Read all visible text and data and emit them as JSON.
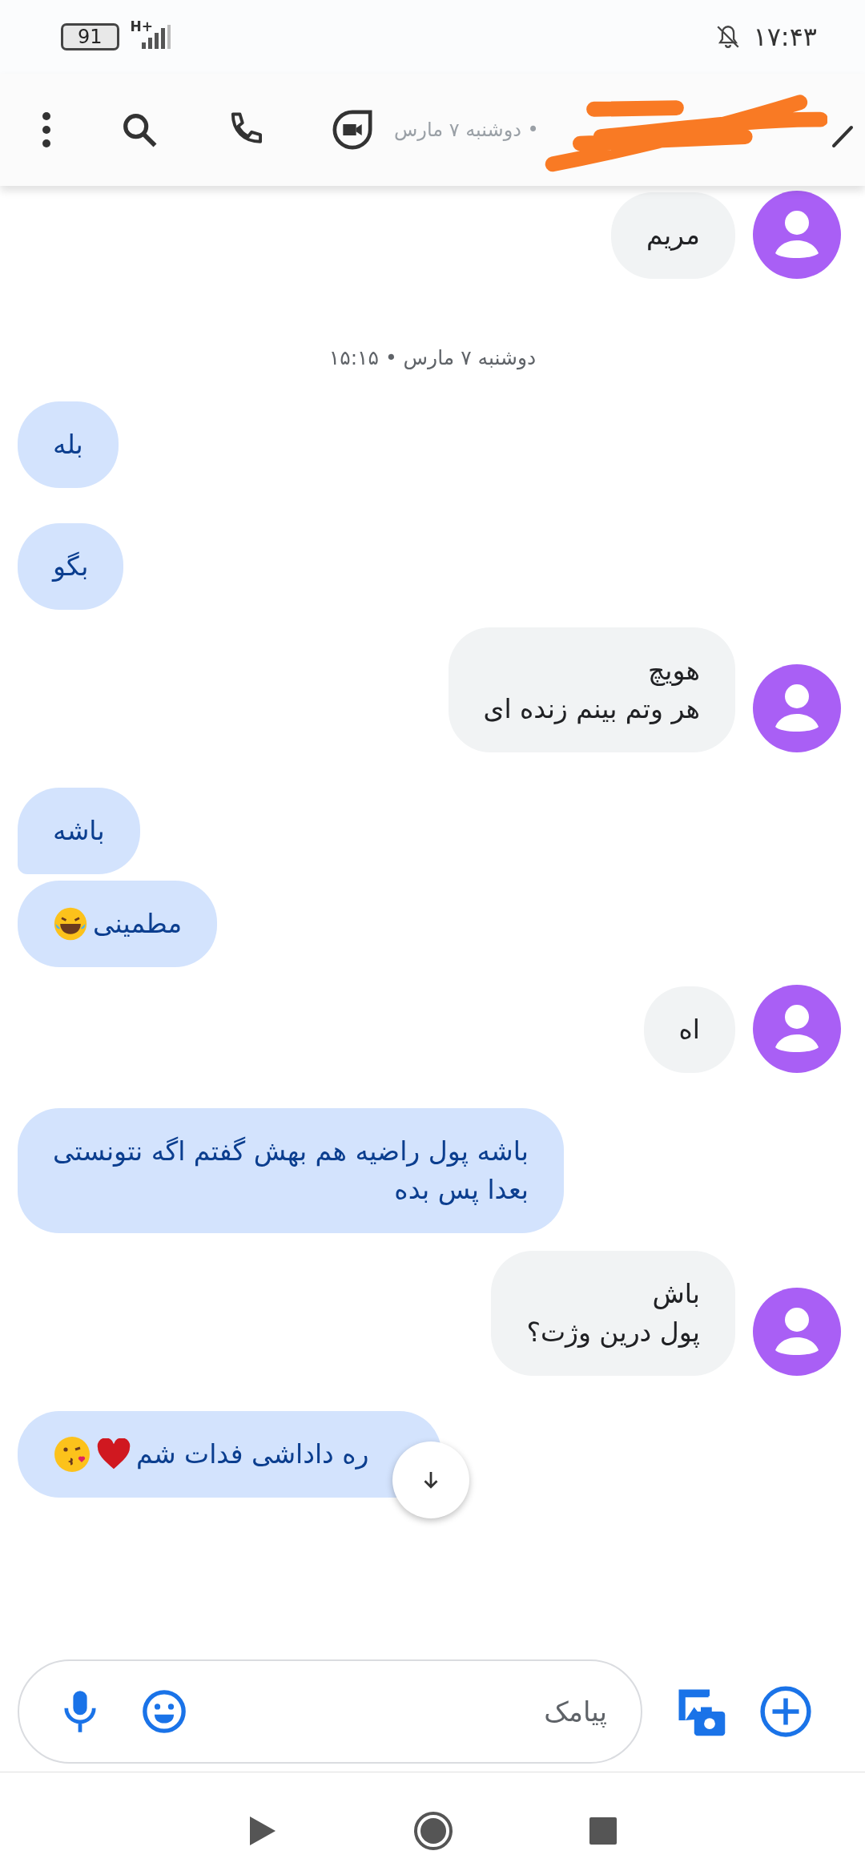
{
  "status_bar": {
    "battery": "91",
    "network": "H+",
    "time": "۱۷:۴۳"
  },
  "header": {
    "subtitle": "دوشنبه ۷ مارس •"
  },
  "messages": [
    {
      "kind": "received",
      "lines": [
        "مریم"
      ]
    },
    {
      "kind": "date",
      "lines": [
        "دوشنبه ۷ مارس • ۱۵:۱۵"
      ]
    },
    {
      "kind": "sent",
      "lines": [
        "بله"
      ]
    },
    {
      "kind": "sent",
      "lines": [
        "بگو"
      ]
    },
    {
      "kind": "received",
      "lines": [
        "هویچ",
        "هر وتم بینم زنده ای"
      ]
    },
    {
      "kind": "sent",
      "lines": [
        "باشه"
      ],
      "grouped": true
    },
    {
      "kind": "sent",
      "lines": [
        "مطمینی"
      ],
      "emoji": [
        {
          "kind": "laugh"
        }
      ]
    },
    {
      "kind": "received",
      "lines": [
        "اه"
      ]
    },
    {
      "kind": "sent",
      "lines": [
        "باشه پول راضیه هم بهش گفتم اگه نتونستی",
        "بعدا پس بده"
      ]
    },
    {
      "kind": "received",
      "lines": [
        "باش",
        "پول درین وژت؟"
      ]
    },
    {
      "kind": "sent",
      "lines": [
        "ره داداشی فدات شم"
      ],
      "emoji": [
        {
          "kind": "heart"
        },
        {
          "kind": "kiss"
        }
      ],
      "scroll_button": true
    }
  ],
  "composer": {
    "placeholder": "پیامک"
  }
}
